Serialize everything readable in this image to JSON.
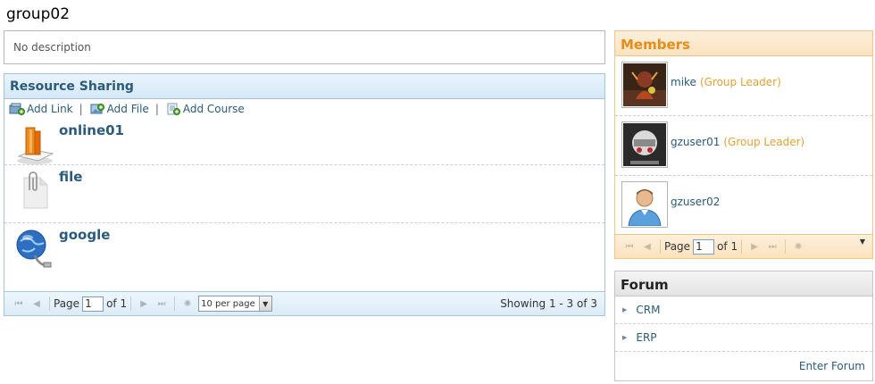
{
  "page": {
    "title": "group02"
  },
  "description": {
    "text": "No description"
  },
  "resources": {
    "title": "Resource Sharing",
    "toolbar": {
      "add_link": "Add Link",
      "add_file": "Add File",
      "add_course": "Add Course",
      "separator": "|"
    },
    "items": [
      {
        "name": "online01",
        "icon": "books-icon"
      },
      {
        "name": "file",
        "icon": "paperclip-file-icon"
      },
      {
        "name": "google",
        "icon": "globe-link-icon"
      }
    ],
    "pager": {
      "page_label": "Page",
      "page_value": "1",
      "of_label": "of 1",
      "per_page": "10 per page",
      "showing": "Showing 1 - 3 of 3"
    }
  },
  "members": {
    "title": "Members",
    "items": [
      {
        "name": "mike",
        "role": "(Group Leader)",
        "avatar": "avatar-mike"
      },
      {
        "name": "gzuser01",
        "role": "(Group Leader)",
        "avatar": "avatar-gzuser01"
      },
      {
        "name": "gzuser02",
        "role": "",
        "avatar": "default-user-avatar"
      }
    ],
    "pager": {
      "page_label": "Page",
      "page_value": "1",
      "of_label": "of 1"
    }
  },
  "forum": {
    "title": "Forum",
    "items": [
      "CRM",
      "ERP"
    ],
    "enter_label": "Enter Forum"
  },
  "colors": {
    "link": "#2b5a7a",
    "members_accent": "#e58d1a",
    "leader_role": "#e0a23a"
  }
}
